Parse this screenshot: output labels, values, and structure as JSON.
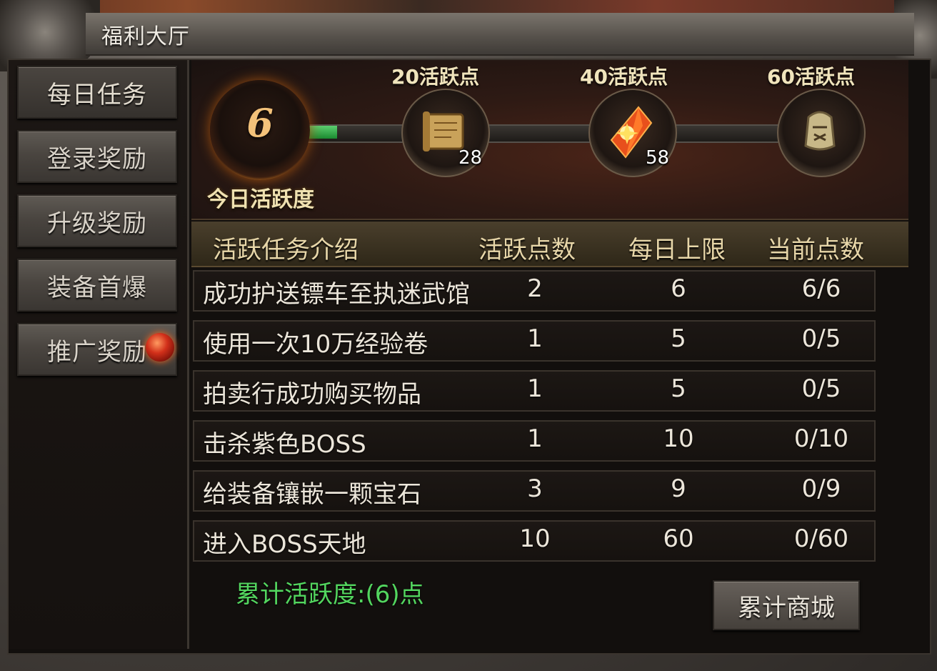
{
  "window": {
    "title": "福利大厅"
  },
  "sidebar": {
    "items": [
      {
        "label": "每日任务",
        "active": true
      },
      {
        "label": "登录奖励",
        "active": false
      },
      {
        "label": "升级奖励",
        "active": false
      },
      {
        "label": "装备首爆",
        "active": false
      },
      {
        "label": "推广奖励",
        "active": false,
        "badge": "red-dot"
      }
    ]
  },
  "activity": {
    "current": "6",
    "label": "今日活跃度",
    "milestones": [
      {
        "label": "20活跃点",
        "count": "28",
        "icon": "scroll-icon"
      },
      {
        "label": "40活跃点",
        "count": "58",
        "icon": "crystal-icon"
      },
      {
        "label": "60活跃点",
        "count": "",
        "icon": "bell-icon"
      }
    ]
  },
  "table": {
    "headers": [
      "活跃任务介绍",
      "活跃点数",
      "每日上限",
      "当前点数"
    ],
    "rows": [
      [
        "成功护送镖车至执迷武馆",
        "2",
        "6",
        "6/6"
      ],
      [
        "使用一次10万经验卷",
        "1",
        "5",
        "0/5"
      ],
      [
        "拍卖行成功购买物品",
        "1",
        "5",
        "0/5"
      ],
      [
        "击杀紫色BOSS",
        "1",
        "10",
        "0/10"
      ],
      [
        "给装备镶嵌一颗宝石",
        "3",
        "9",
        "0/9"
      ],
      [
        "进入BOSS天地",
        "10",
        "60",
        "0/60"
      ]
    ]
  },
  "footer": {
    "total": "累计活跃度:(6)点",
    "shop_button": "累计商城"
  },
  "colors": {
    "total_text": "#53d65f",
    "progress_fill": "#3cb550",
    "header_text": "#e7d6a8"
  }
}
